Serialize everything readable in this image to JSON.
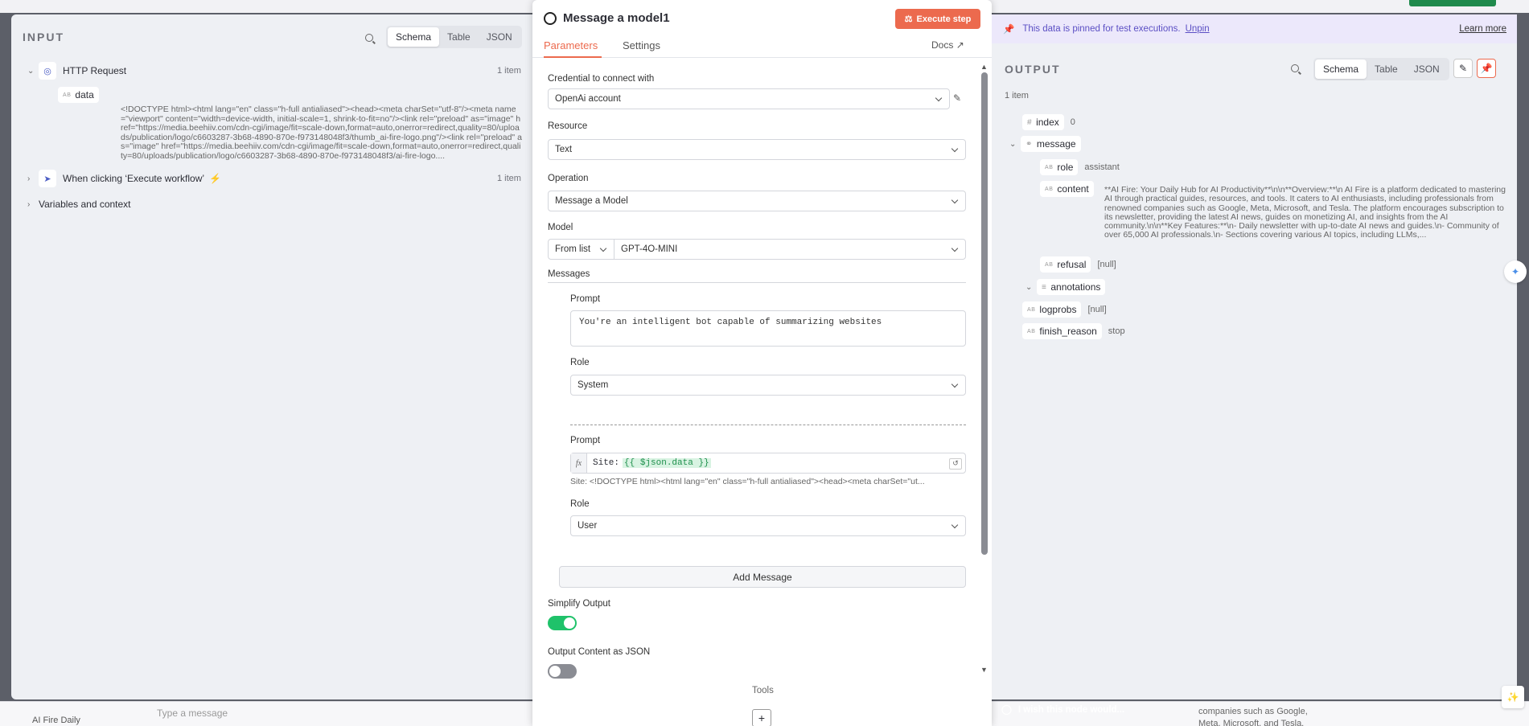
{
  "background": {
    "chat_label": "AI Fire Daily",
    "chat_placeholder": "Type a message",
    "right_snippet": "companies such as Google, Meta, Microsoft, and Tesla. The platform",
    "feedback_text": "I wish this node would..."
  },
  "input": {
    "title": "INPUT",
    "views": [
      "Schema",
      "Table",
      "JSON"
    ],
    "active_view": "Schema",
    "http_node": "HTTP Request",
    "http_count": "1 item",
    "data_key": "data",
    "data_value": "<!DOCTYPE html><html lang=\"en\" class=\"h-full antialiased\"><head><meta charSet=\"utf-8\"/><meta name=\"viewport\" content=\"width=device-width, initial-scale=1, shrink-to-fit=no\"/><link rel=\"preload\" as=\"image\" href=\"https://media.beehiiv.com/cdn-cgi/image/fit=scale-down,format=auto,onerror=redirect,quality=80/uploads/publication/logo/c6603287-3b68-4890-870e-f973148048f3/thumb_ai-fire-logo.png\"/><link rel=\"preload\" as=\"image\" href=\"https://media.beehiiv.com/cdn-cgi/image/fit=scale-down,format=auto,onerror=redirect,quality=80/uploads/publication/logo/c6603287-3b68-4890-870e-f973148048f3/ai-fire-logo....",
    "trigger_node": "When clicking ‘Execute workflow’",
    "trigger_count": "1 item",
    "vars": "Variables and context"
  },
  "node": {
    "title": "Message a model1",
    "execute_label": "Execute step",
    "tabs": [
      "Parameters",
      "Settings"
    ],
    "docs": "Docs",
    "credential_label": "Credential to connect with",
    "credential_value": "OpenAi account",
    "resource_label": "Resource",
    "resource_value": "Text",
    "operation_label": "Operation",
    "operation_value": "Message a Model",
    "model_label": "Model",
    "model_mode": "From list",
    "model_value": "GPT-4O-MINI",
    "messages_label": "Messages",
    "msg1_prompt_label": "Prompt",
    "msg1_prompt": "You're an intelligent bot capable of summarizing websites",
    "msg1_role_label": "Role",
    "msg1_role": "System",
    "msg2_prompt_label": "Prompt",
    "msg2_prefix": "Site:",
    "msg2_expr": "{{ $json.data }}",
    "msg2_preview": "Site: <!DOCTYPE html><html lang=\"en\" class=\"h-full antialiased\"><head><meta charSet=\"ut...",
    "msg2_role_label": "Role",
    "msg2_role": "User",
    "add_message": "Add Message",
    "simplify_label": "Simplify Output",
    "simplify_on": true,
    "json_label": "Output Content as JSON",
    "json_on": false,
    "tools_label": "Tools",
    "plus": "+"
  },
  "output": {
    "pinned_text": "This data is pinned for test executions.",
    "unpin": "Unpin",
    "learn_more": "Learn more",
    "title": "OUTPUT",
    "views": [
      "Schema",
      "Table",
      "JSON"
    ],
    "active_view": "Schema",
    "count": "1 item",
    "index_key": "index",
    "index_val": "0",
    "message_key": "message",
    "role_key": "role",
    "role_val": "assistant",
    "content_key": "content",
    "content_val": "**AI Fire: Your Daily Hub for AI Productivity**\\n\\n**Overview:**\\n AI Fire is a platform dedicated to mastering AI through practical guides, resources, and tools. It caters to AI enthusiasts, including professionals from renowned companies such as Google, Meta, Microsoft, and Tesla. The platform encourages subscription to its newsletter, providing the latest AI news, guides on monetizing AI, and insights from the AI community.\\n\\n**Key Features:**\\n- Daily newsletter with up-to-date AI news and guides.\\n- Community of over 65,000 AI professionals.\\n- Sections covering various AI topics, including LLMs,...",
    "refusal_key": "refusal",
    "refusal_val": "[null]",
    "annotations_key": "annotations",
    "logprobs_key": "logprobs",
    "logprobs_val": "[null]",
    "finish_key": "finish_reason",
    "finish_val": "stop"
  },
  "colors": {
    "accent": "#ec6a4e",
    "toggle_on": "#1fc26a",
    "toggle_off": "#8a8c93",
    "pinned_bg": "#ece8fb"
  }
}
